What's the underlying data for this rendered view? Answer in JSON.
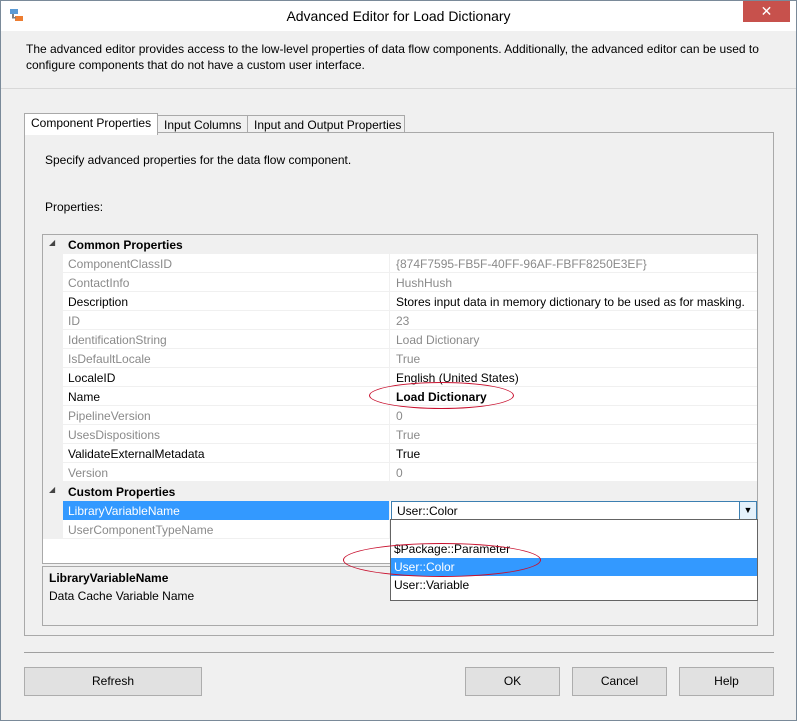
{
  "window": {
    "title": "Advanced Editor for Load Dictionary",
    "close_label": "✕",
    "description": "The advanced editor provides access to the low-level properties of data flow components. Additionally, the advanced editor can be used to configure components that do not have a custom user interface."
  },
  "tabs": [
    {
      "label": "Component Properties",
      "active": true
    },
    {
      "label": "Input Columns",
      "active": false
    },
    {
      "label": "Input and Output Properties",
      "active": false
    }
  ],
  "panel": {
    "intro": "Specify advanced properties for the data flow component.",
    "properties_label": "Properties:"
  },
  "grid": {
    "categories": [
      "Common Properties",
      "Custom Properties"
    ],
    "common": [
      {
        "name": "ComponentClassID",
        "value": "{874F7595-FB5F-40FF-96AF-FBFF8250E3EF}",
        "readonly": true
      },
      {
        "name": "ContactInfo",
        "value": "HushHush",
        "readonly": true
      },
      {
        "name": "Description",
        "value": "Stores input data in memory dictionary to be used as for masking.",
        "readonly": false
      },
      {
        "name": "ID",
        "value": "23",
        "readonly": true
      },
      {
        "name": "IdentificationString",
        "value": "Load Dictionary",
        "readonly": true
      },
      {
        "name": "IsDefaultLocale",
        "value": "True",
        "readonly": true
      },
      {
        "name": "LocaleID",
        "value": "English (United States)",
        "readonly": false
      },
      {
        "name": "Name",
        "value": "Load Dictionary",
        "readonly": false
      },
      {
        "name": "PipelineVersion",
        "value": "0",
        "readonly": true
      },
      {
        "name": "UsesDispositions",
        "value": "True",
        "readonly": true
      },
      {
        "name": "ValidateExternalMetadata",
        "value": "True",
        "readonly": false
      },
      {
        "name": "Version",
        "value": "0",
        "readonly": true
      }
    ],
    "custom": [
      {
        "name": "LibraryVariableName",
        "value": "User::Color",
        "readonly": false
      },
      {
        "name": "UserComponentTypeName",
        "value": "",
        "readonly": true
      }
    ]
  },
  "dropdown": {
    "items": [
      "$Package::Parameter",
      "User::Color",
      "User::Variable"
    ],
    "selected": "User::Color"
  },
  "description_panel": {
    "title": "LibraryVariableName",
    "text": "Data Cache Variable Name"
  },
  "buttons": {
    "refresh": "Refresh",
    "ok": "OK",
    "cancel": "Cancel",
    "help": "Help"
  },
  "colors": {
    "selection": "#3399ff",
    "annotation": "#c8102e",
    "readonly_text": "#8a8a8a"
  }
}
